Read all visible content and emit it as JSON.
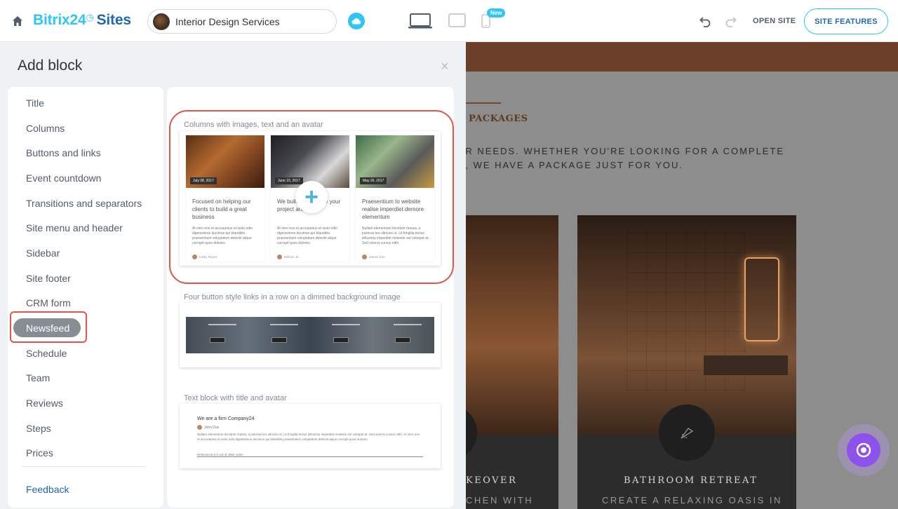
{
  "topbar": {
    "brand_main": "Bitrix24",
    "brand_sites": "Sites",
    "site_name": "Interior Design Services",
    "new_badge": "New",
    "open_site": "OPEN SITE",
    "site_features": "SITE FEATURES"
  },
  "panel": {
    "title": "Add block",
    "close": "×",
    "categories": [
      {
        "label": "Title"
      },
      {
        "label": "Columns"
      },
      {
        "label": "Buttons and links"
      },
      {
        "label": "Event countdown"
      },
      {
        "label": "Transitions and separators"
      },
      {
        "label": "Site menu and header"
      },
      {
        "label": "Sidebar"
      },
      {
        "label": "Site footer"
      },
      {
        "label": "CRM form"
      },
      {
        "label": "Newsfeed"
      },
      {
        "label": "Schedule"
      },
      {
        "label": "Team"
      },
      {
        "label": "Reviews"
      },
      {
        "label": "Steps"
      },
      {
        "label": "Prices"
      }
    ],
    "active_category": "Newsfeed",
    "feedback": "Feedback"
  },
  "blocks": [
    {
      "label": "Columns with images, text and an avatar",
      "columns": [
        {
          "date": "July 08, 2017",
          "heading": "Focused on helping our clients to build a great business",
          "body": "At vero eos et accusamus et iusto odio dignissimos ducimus qui blanditiis praesentium voluptatum deleniti atque corrupti quos dolores.",
          "author": "Kathy Reyes"
        },
        {
          "date": "June 15, 2017",
          "heading": "We build and realise your project and more",
          "body": "At vero eos et accusamus et iusto odio dignissimos ducimus qui blanditiis praesentium voluptatum deleniti atque corrupti quos dolores.",
          "author": "William Jb"
        },
        {
          "date": "May 26, 2017",
          "heading": "Praesentium to website realise imperdiet demore elementum",
          "body": "Nullam elementum tincidunt massa, a pulvinar leo ultricies ut. Ut fringilla lectus tellusimp imperdiet molestie est volutpat at. Sed viverra cursus nibh.",
          "author": "James Doe"
        }
      ],
      "plus": "+"
    },
    {
      "label": "Four button style links in a row on a dimmed background image"
    },
    {
      "label": "Text block with title and avatar",
      "title": "We are a firm Company24",
      "author": "John Doe",
      "body": "Nullam elementum tincidunt massa, a pulvinar leo ultricies ut. Ut fringilla lectus tellusimp imperdiet molestie est volutpat at. Sed viverra cursus nibh. At vero eos et accusamus et iusto odio dignissimos ducimus qui blanditiis praesentium voluptatum deleniti atque corrupti quos dolores.",
      "meta": "Relevancia 5.0 out of 4962 votes"
    }
  ],
  "preview": {
    "packages": "PACKAGES",
    "intro": "UR NEEDS. WHETHER YOU'RE LOOKING FOR A COMPLETE H, WE HAVE A PACKAGE JUST FOR YOU.",
    "card_left_title": "KEOVER",
    "card_left_sub": "CHEN WITH",
    "card_right_title": "BATHROOM RETREAT",
    "card_right_sub": "CREATE A RELAXING OASIS IN"
  },
  "colors": {
    "accent": "#2fc6f6",
    "brand_dark": "#2067b0",
    "highlight": "#e5544a"
  },
  "icons": [
    "home-icon",
    "cloud-icon",
    "laptop-icon",
    "tablet-icon",
    "phone-icon",
    "undo-icon",
    "redo-icon",
    "close-icon",
    "plus-icon",
    "shower-icon",
    "copilot-icon"
  ]
}
